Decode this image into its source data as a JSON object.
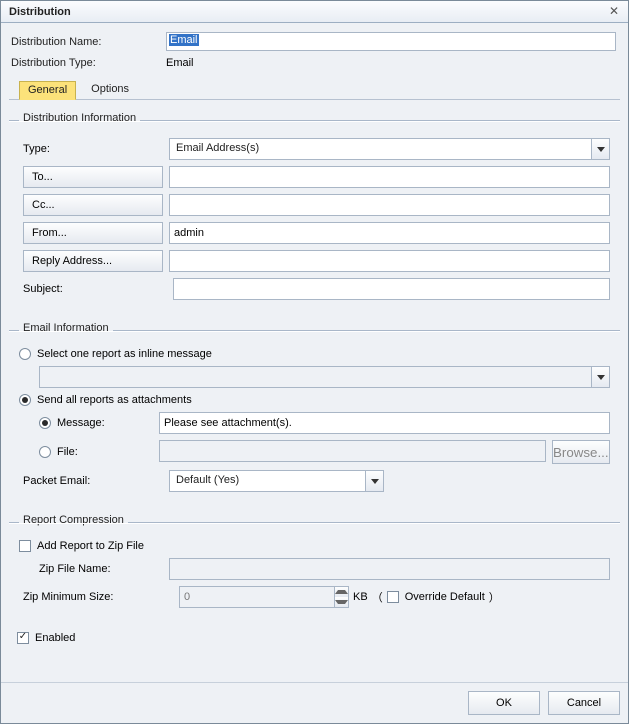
{
  "dialog": {
    "title": "Distribution"
  },
  "header": {
    "name_label": "Distribution Name:",
    "name_value": "Email",
    "type_label": "Distribution Type:",
    "type_value": "Email"
  },
  "tabs": {
    "general": "General",
    "options": "Options"
  },
  "dist_info": {
    "legend": "Distribution Information",
    "type_label": "Type:",
    "type_value": "Email Address(s)",
    "to_label": "To...",
    "to_value": "",
    "cc_label": "Cc...",
    "cc_value": "",
    "from_label": "From...",
    "from_value": "admin",
    "reply_label": "Reply Address...",
    "reply_value": "",
    "subject_label": "Subject:",
    "subject_value": ""
  },
  "email_info": {
    "legend": "Email Information",
    "opt_inline": "Select one report as inline message",
    "inline_value": "",
    "opt_attach": "Send all reports as attachments",
    "sub_message": "Message:",
    "message_value": "Please see attachment(s).",
    "sub_file": "File:",
    "file_value": "",
    "browse": "Browse...",
    "packet_label": "Packet Email:",
    "packet_value": "Default (Yes)"
  },
  "compression": {
    "legend": "Report Compression",
    "add_zip": "Add Report to Zip File",
    "zip_name_label": "Zip File Name:",
    "zip_name_value": "",
    "zip_min_label": "Zip Minimum Size:",
    "zip_min_value": "0",
    "kb": "KB",
    "override": "Override Default"
  },
  "enabled_label": "Enabled",
  "buttons": {
    "ok": "OK",
    "cancel": "Cancel"
  }
}
